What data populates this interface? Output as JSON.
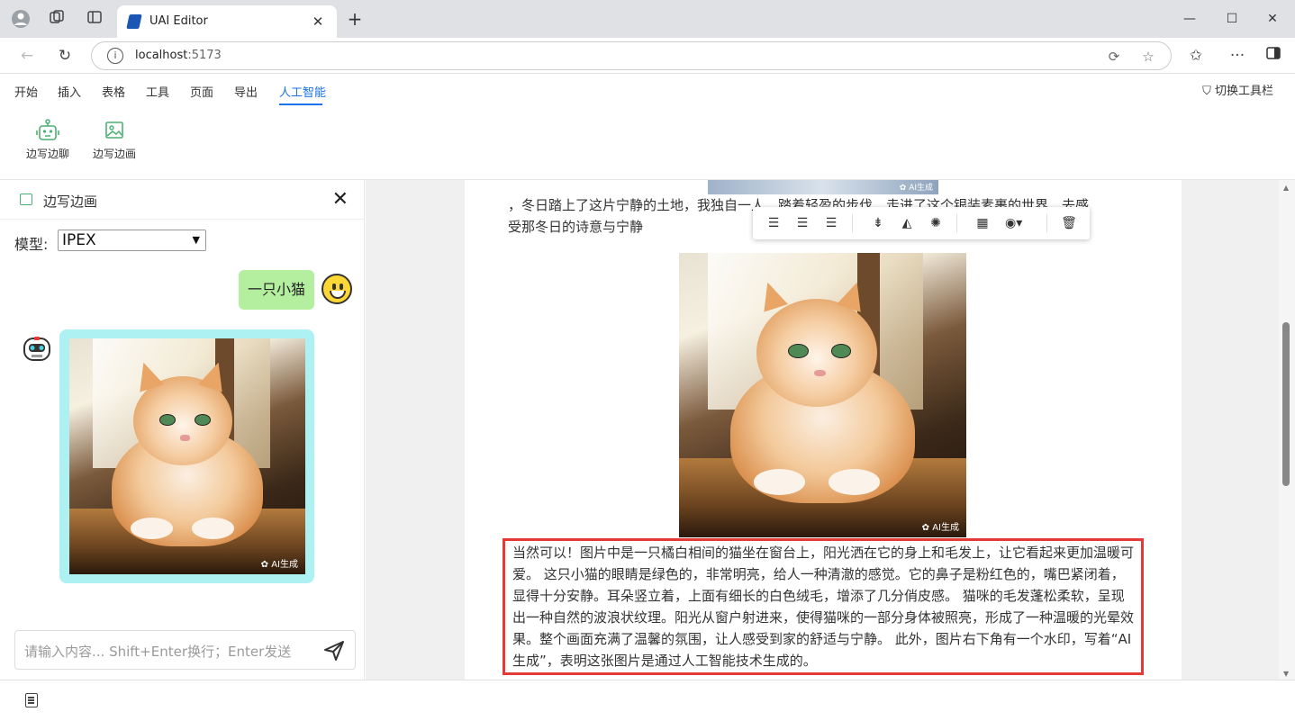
{
  "browser": {
    "tab_title": "UAI Editor",
    "new_tab": "+",
    "close_tab": "✕",
    "url_host": "localhost",
    "url_port": ":5173",
    "window_controls": [
      "—",
      "☐",
      "✕"
    ]
  },
  "menu": {
    "items": [
      "开始",
      "插入",
      "表格",
      "工具",
      "页面",
      "导出",
      "人工智能"
    ],
    "active": "人工智能",
    "switch_toolbar": "切换工具栏"
  },
  "ribbon": {
    "buttons": [
      {
        "label": "边写边聊",
        "icon": "robot-icon"
      },
      {
        "label": "边写边画",
        "icon": "image-icon"
      }
    ]
  },
  "panel": {
    "title": "边写边画",
    "model_label": "模型:",
    "model_value": "IPEX",
    "user_message": "一只小猫",
    "watermark": "AI生成",
    "input_placeholder": "请输入内容... Shift+Enter换行；Enter发送"
  },
  "document": {
    "top_image_watermark": "AI生成",
    "paragraph1_line1": "，冬日踏上了这片宁静的土地，我独自一人，踏着轻盈的步伐，走进了这个银装素裹的世界，去感",
    "paragraph1_line2": "受那冬日的诗意与宁静",
    "image_watermark": "AI生成",
    "answer": "当然可以！图片中是一只橘白相间的猫坐在窗台上，阳光洒在它的身上和毛发上，让它看起来更加温暖可爱。 这只小猫的眼睛是绿色的，非常明亮，给人一种清澈的感觉。它的鼻子是粉红色的，嘴巴紧闭着，显得十分安静。耳朵竖立着，上面有细长的白色绒毛，增添了几分俏皮感。 猫咪的毛发蓬松柔软，呈现出一种自然的波浪状纹理。阳光从窗户射进来，使得猫咪的一部分身体被照亮，形成了一种温暖的光晕效果。整个画面充满了温馨的氛围，让人感受到家的舒适与宁静。 此外，图片右下角有一个水印，写着“AI生成”，表明这张图片是通过人工智能技术生成的。"
  },
  "colors": {
    "accent": "#1a73e8",
    "user_bubble": "#b3ef9f",
    "ai_bubble": "#aef1f3",
    "highlight_border": "#e53935"
  }
}
